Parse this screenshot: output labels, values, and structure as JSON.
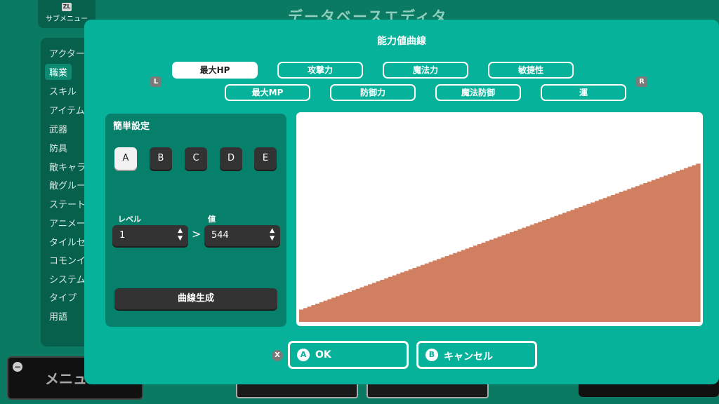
{
  "background": {
    "submenu_key": "ZL",
    "submenu_label": "サブメニュー",
    "title": "データベースエディタ",
    "list_items": [
      "アクター",
      "職業",
      "スキル",
      "アイテム",
      "武器",
      "防具",
      "敵キャラ",
      "敵グループ",
      "ステート",
      "アニメーション",
      "タイルセット",
      "コモンイベント",
      "システム",
      "タイプ",
      "用語"
    ],
    "menu_label": "メニュー"
  },
  "dialog": {
    "title": "能力値曲線",
    "key_left": "L",
    "key_right": "R",
    "tabs_row1": [
      "最大HP",
      "攻撃力",
      "魔法力",
      "敏捷性"
    ],
    "tabs_row2": [
      "最大MP",
      "防御力",
      "魔法防御",
      "運"
    ],
    "selected_tab": "最大HP",
    "panel": {
      "title": "簡単設定",
      "presets": [
        "A",
        "B",
        "C",
        "D",
        "E"
      ],
      "selected_preset": "A",
      "level_label": "レベル",
      "level_value": "1",
      "value_label": "値",
      "value_value": "544",
      "arrow": ">",
      "generate_label": "曲線生成"
    },
    "x_key": "X",
    "ok_key": "A",
    "ok_label": "OK",
    "cancel_key": "B",
    "cancel_label": "キャンセル"
  },
  "chart_data": {
    "type": "bar",
    "bar_color": "#d08060",
    "points": 99,
    "start_fraction": 0.06,
    "end_fraction": 0.77
  }
}
